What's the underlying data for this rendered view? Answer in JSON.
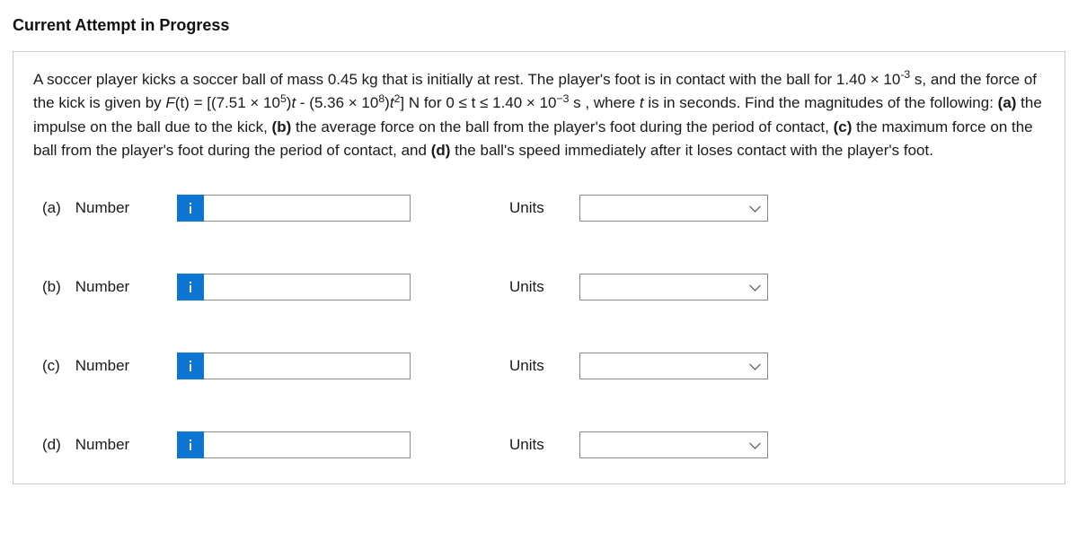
{
  "heading": "Current Attempt in Progress",
  "question": {
    "pre": "A soccer player kicks a soccer ball of mass 0.45 kg that is initially at rest. The player's foot is in contact with the ball for 1.40 × 10",
    "exp1": "-3",
    "pre2": " s, and the force of the kick is given by ",
    "F": "F",
    "tparen": "(t) = [(7.51 × 10",
    "exp2": "5",
    "mid1": ")",
    "t1": "t",
    "mid1b": " - (5.36 × 10",
    "exp3": "8",
    "mid2": ")",
    "t2": "t",
    "sq": "2",
    "mid3": "] N for ",
    "range": "0 ≤ t ≤ 1.40 × 10",
    "exp4": "−3",
    "post": " s , where ",
    "t3": "t",
    "post2": " is in seconds. Find the magnitudes of the following: ",
    "a": "(a)",
    "atext": " the impulse on the ball due to the kick, ",
    "b": "(b)",
    "btext": " the average force on the ball from the player's foot during the period of contact, ",
    "c": "(c)",
    "ctext": " the maximum force on the ball from the player's foot during the period of contact, and ",
    "d": "(d)",
    "dtext": " the ball's speed immediately after it loses contact with the player's foot."
  },
  "parts": {
    "a": {
      "letter": "(a)",
      "label": "Number",
      "units": "Units"
    },
    "b": {
      "letter": "(b)",
      "label": "Number",
      "units": "Units"
    },
    "c": {
      "letter": "(c)",
      "label": "Number",
      "units": "Units"
    },
    "d": {
      "letter": "(d)",
      "label": "Number",
      "units": "Units"
    }
  }
}
